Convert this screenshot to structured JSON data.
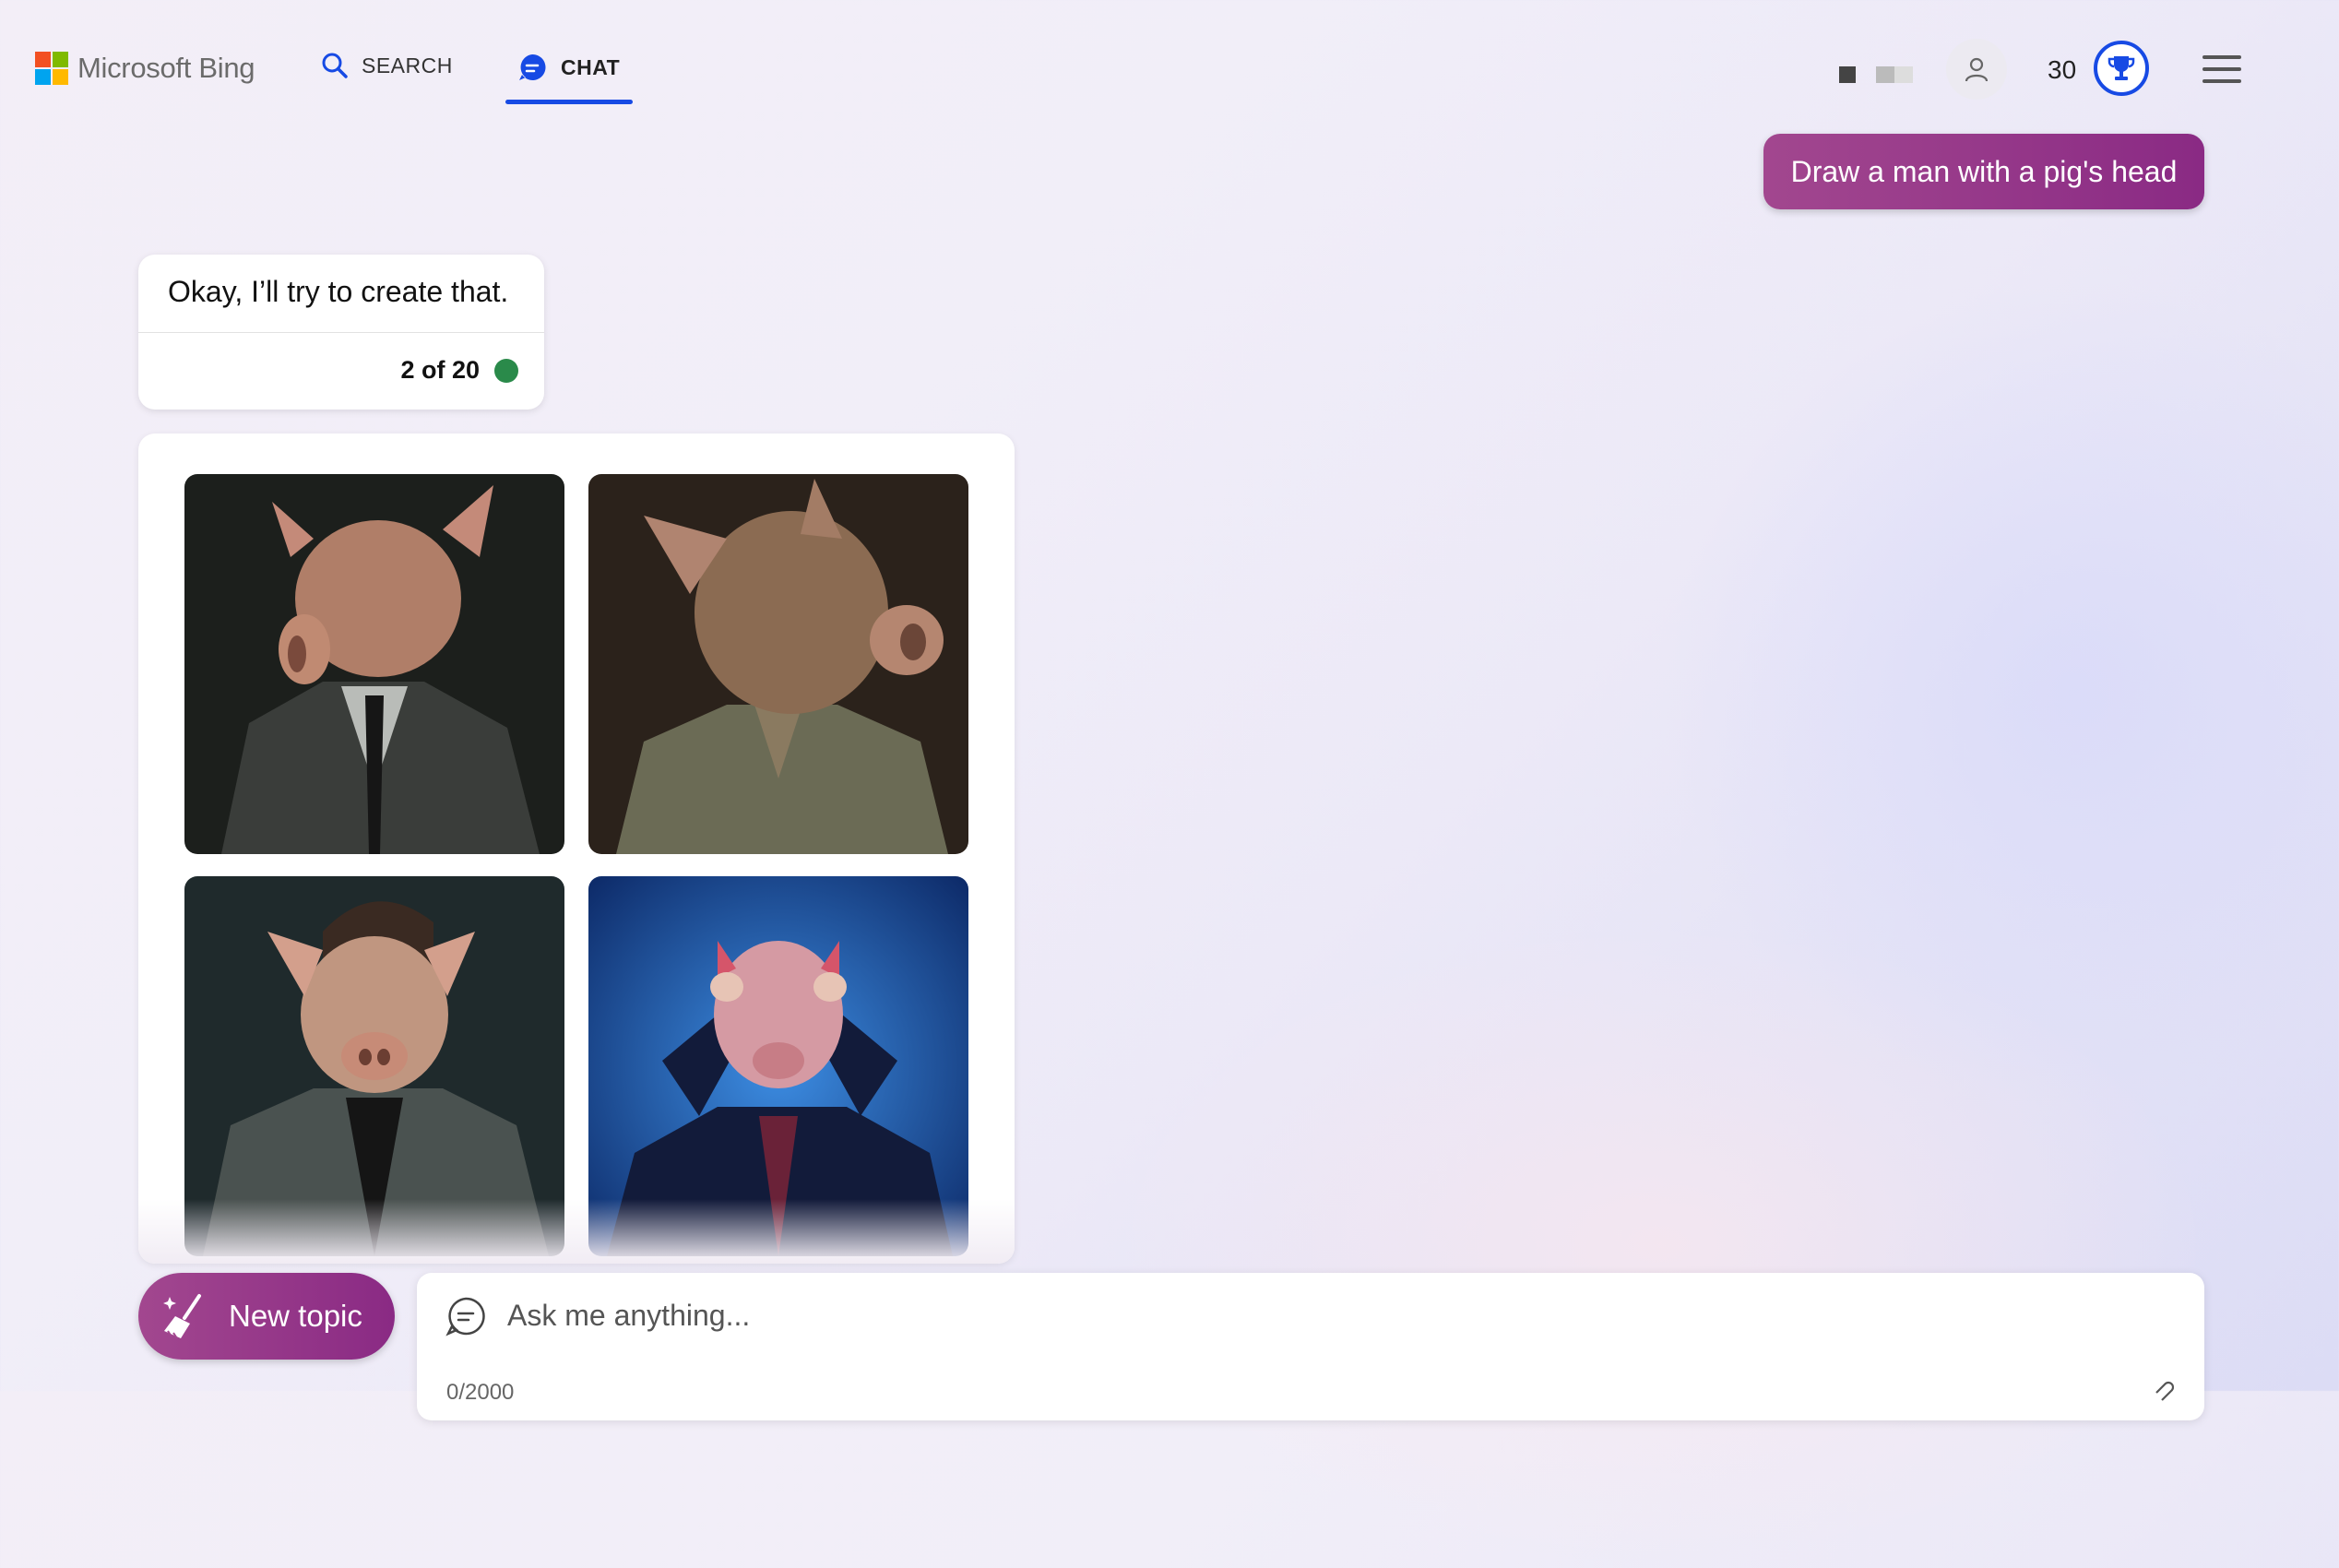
{
  "header": {
    "brand": "Microsoft Bing",
    "tabs": [
      {
        "label": "SEARCH",
        "icon": "search-icon",
        "active": false
      },
      {
        "label": "CHAT",
        "icon": "chat-icon",
        "active": true
      }
    ],
    "points": "30",
    "accent_color": "#174ae4"
  },
  "conversation": {
    "user_message": "Draw a man with a pig's head",
    "bot_message": "Okay, I’ll try to create that.",
    "turn_counter": "2 of 20",
    "status_color": "#2a8a4a",
    "images": [
      {
        "alt": "man in dark suit and tie with pig head"
      },
      {
        "alt": "man in olive shirt with pig head"
      },
      {
        "alt": "man in denim jacket with pig head"
      },
      {
        "alt": "man in navy suit holding pig head mask"
      }
    ]
  },
  "composer": {
    "new_topic_label": "New topic",
    "placeholder": "Ask me anything...",
    "char_count": "0/2000",
    "bubble_color": "#94328a"
  }
}
